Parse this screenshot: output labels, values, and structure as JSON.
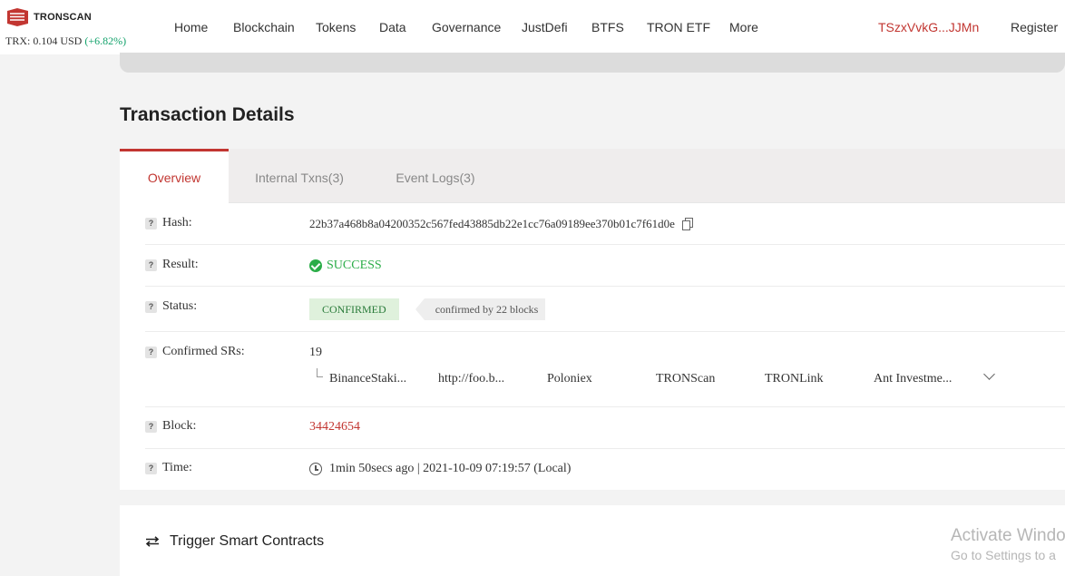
{
  "header": {
    "logo_text": "TRONSCAN",
    "price_label": "TRX: 0.104 USD",
    "price_change": "(+6.82%)",
    "nav": [
      "Home",
      "Blockchain",
      "Tokens",
      "Data",
      "Governance",
      "JustDefi",
      "BTFS",
      "TRON ETF",
      "More"
    ],
    "account": "TSzxVvkG...JJMn",
    "register": "Register"
  },
  "page_title": "Transaction Details",
  "tabs": [
    "Overview",
    "Internal Txns(3)",
    "Event Logs(3)"
  ],
  "details": {
    "hash_label": "Hash:",
    "hash_value": "22b37a468b8a04200352c567fed43885db22e1cc76a09189ee370b01c7f61d0e",
    "result_label": "Result:",
    "result_value": "SUCCESS",
    "status_label": "Status:",
    "status_value": "CONFIRMED",
    "status_blocks": "confirmed by 22 blocks",
    "srs_label": "Confirmed SRs:",
    "srs_count": "19",
    "srs_list": [
      "BinanceStaki...",
      "http://foo.b...",
      "Poloniex",
      "TRONScan",
      "TRONLink",
      "Ant Investme..."
    ],
    "block_label": "Block:",
    "block_value": "34424654",
    "time_label": "Time:",
    "time_value": "1min 50secs ago | 2021-10-09 07:19:57 (Local)"
  },
  "trigger_title": "Trigger Smart Contracts",
  "watermark": {
    "line1": "Activate Windo",
    "line2": "Go to Settings to a"
  },
  "colors": {
    "brand_red": "#c23631",
    "success_green": "#2bad48",
    "price_green": "#12a26b"
  }
}
